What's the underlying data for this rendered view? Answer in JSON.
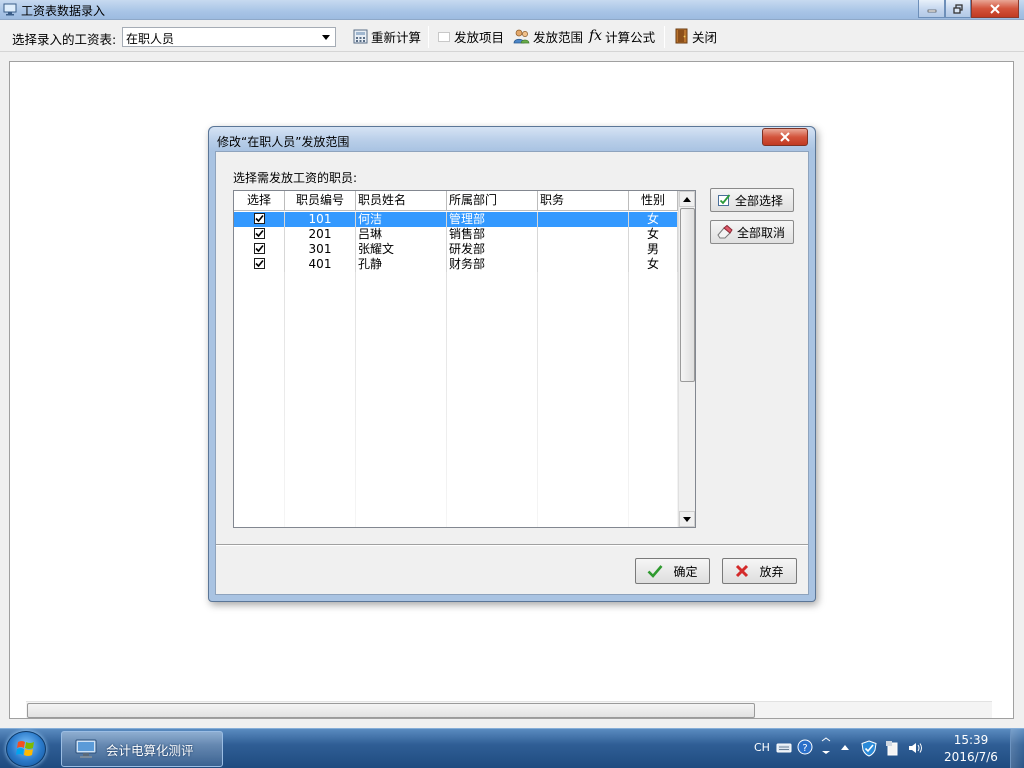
{
  "window": {
    "title": "工资表数据录入"
  },
  "toolbar": {
    "select_label": "选择录入的工资表:",
    "select_value": "在职人员",
    "recalc_label": "重新计算",
    "items_label": "发放项目",
    "range_label": "发放范围",
    "formula_label": "计算公式",
    "close_label": "关闭"
  },
  "dialog": {
    "title": "修改“在职人员”发放范围",
    "prompt": "选择需发放工资的职员:",
    "columns": [
      "选择",
      "职员编号",
      "职员姓名",
      "所属部门",
      "职务",
      "性别"
    ],
    "rows": [
      {
        "checked": true,
        "id": "101",
        "name": "何洁",
        "dept": "管理部",
        "title": "",
        "gender": "女",
        "selected": true
      },
      {
        "checked": true,
        "id": "201",
        "name": "吕琳",
        "dept": "销售部",
        "title": "",
        "gender": "女",
        "selected": false
      },
      {
        "checked": true,
        "id": "301",
        "name": "张耀文",
        "dept": "研发部",
        "title": "",
        "gender": "男",
        "selected": false
      },
      {
        "checked": true,
        "id": "401",
        "name": "孔静",
        "dept": "财务部",
        "title": "",
        "gender": "女",
        "selected": false
      }
    ],
    "select_all_label": "全部选择",
    "deselect_all_label": "全部取消",
    "ok_label": "确定",
    "cancel_label": "放弃"
  },
  "taskbar": {
    "app_label": "会计电算化测评",
    "lang": "CH",
    "time": "15:39",
    "date": "2016/7/6"
  },
  "colors": {
    "selection": "#3399ff",
    "titlebar": "#a9c3e2",
    "taskbar": "#2f5e95"
  },
  "icons": [
    "app-window-icon",
    "minimize-icon",
    "restore-icon",
    "close-icon",
    "calculator-icon",
    "checkbox-icon",
    "users-icon",
    "fx-icon",
    "door-icon",
    "check-icon",
    "eraser-icon",
    "x-icon",
    "windows-logo-icon",
    "monitor-icon",
    "keyboard-icon",
    "help-icon",
    "shield-icon",
    "volume-icon"
  ]
}
